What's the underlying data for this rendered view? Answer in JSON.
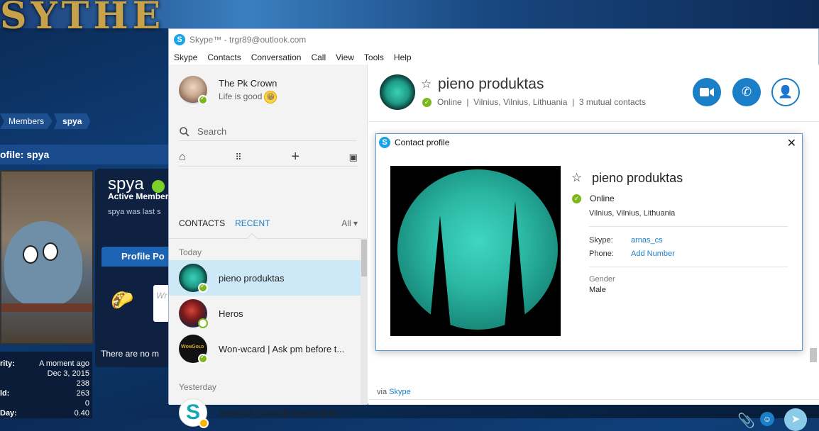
{
  "background": {
    "logo_text": "SYTHE",
    "breadcrumbs": [
      "Members",
      "spya"
    ],
    "profile_heading": "ofile: spya",
    "username": "spya",
    "rank": "Active Member",
    "last_seen": "spya was last s",
    "profile_tab": "Profile Po",
    "comment_placeholder": "Wr",
    "no_more": "There are no m",
    "stats": [
      {
        "label": "rity:",
        "value": "A moment ago"
      },
      {
        "label": "",
        "value": "Dec 3, 2015"
      },
      {
        "label": "",
        "value": "238"
      },
      {
        "label": "ld:",
        "value": "263"
      },
      {
        "label": "",
        "value": "0"
      },
      {
        "label": "Day:",
        "value": "0.40"
      }
    ]
  },
  "window": {
    "title": "Skype™ - trgr89@outlook.com",
    "menu": [
      "Skype",
      "Contacts",
      "Conversation",
      "Call",
      "View",
      "Tools",
      "Help"
    ]
  },
  "me": {
    "name": "The Pk Crown",
    "mood": "Life is good"
  },
  "search": {
    "placeholder": "Search"
  },
  "tabs": {
    "contacts": "CONTACTS",
    "recent": "RECENT",
    "filter": "All"
  },
  "sections": {
    "today": "Today",
    "yesterday": "Yesterday"
  },
  "recent": [
    {
      "name": "pieno produktas",
      "status": "online"
    },
    {
      "name": "Heros",
      "status": "away"
    },
    {
      "name": "Won-wcard | Ask pm before t...",
      "status": "online"
    },
    {
      "name": "Samirk3 [Donor][Vouched] Ai...",
      "status": "idle"
    }
  ],
  "conversation": {
    "name": "pieno produktas",
    "status": "Online",
    "location": "Vilnius, Vilnius, Lithuania",
    "mutual": "3 mutual contacts",
    "via_prefix": "via",
    "via_link": "Skype"
  },
  "dialog": {
    "title": "Contact profile",
    "name": "pieno produktas",
    "status": "Online",
    "location": "Vilnius, Vilnius, Lithuania",
    "skype_label": "Skype:",
    "skype_value": "arnas_cs",
    "phone_label": "Phone:",
    "phone_value": "Add Number",
    "gender_label": "Gender",
    "gender_value": "Male"
  },
  "colors": {
    "accent": "#1a7fc7",
    "online": "#7bb81e",
    "selected": "#cde9f8"
  }
}
